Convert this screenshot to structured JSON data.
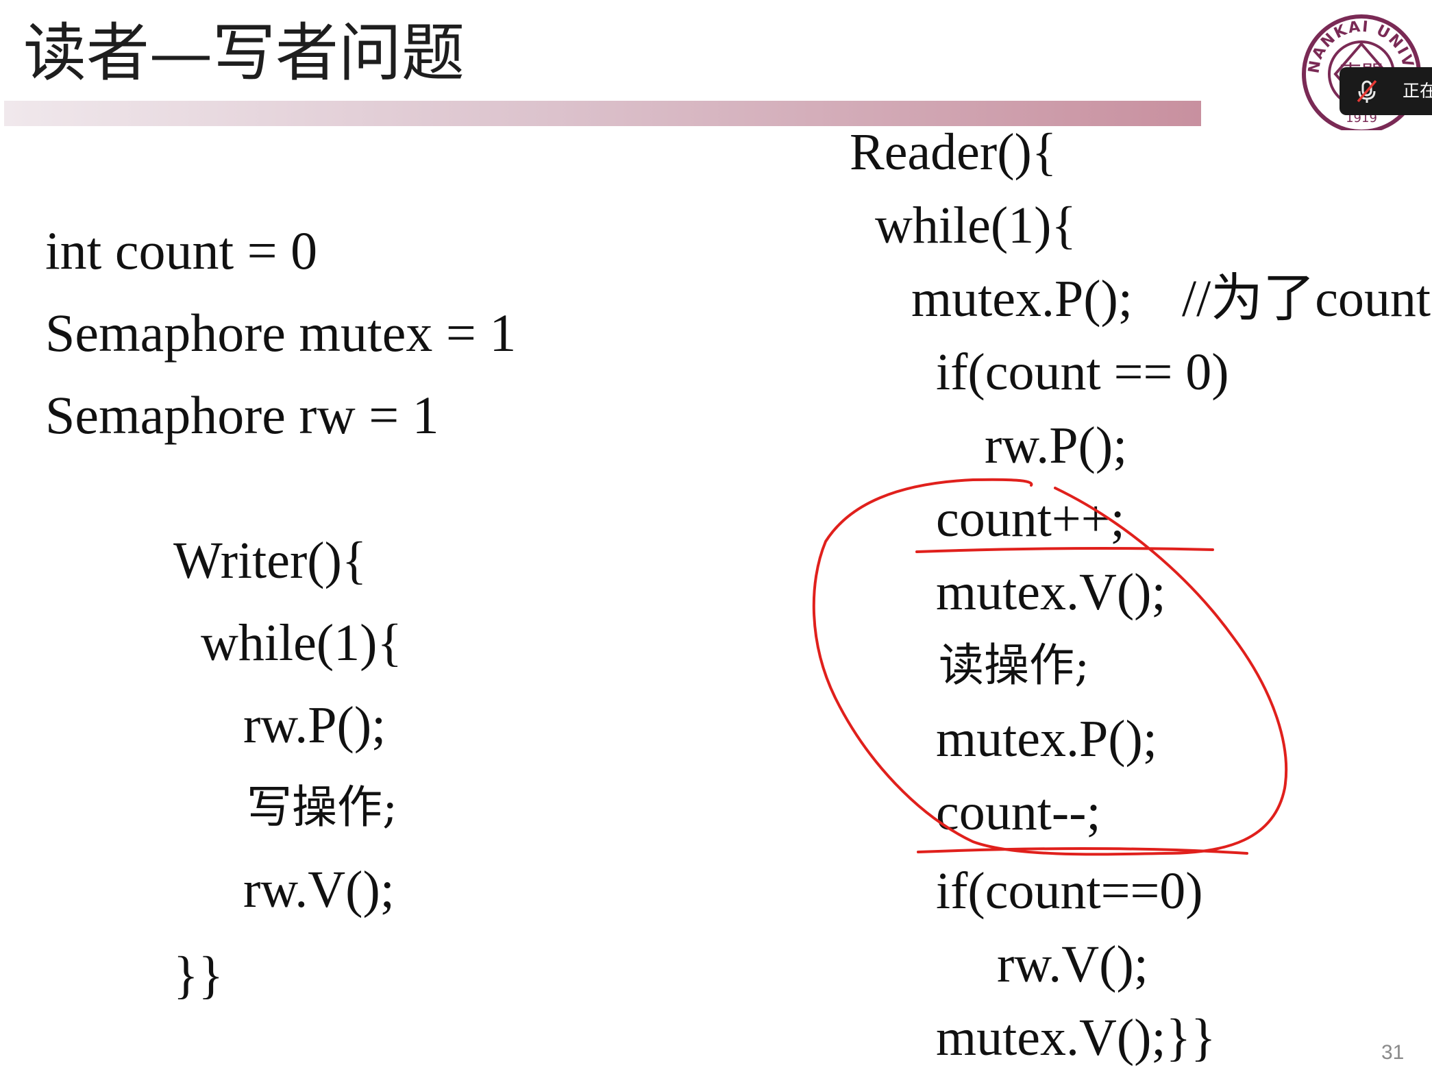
{
  "slide": {
    "title": "读者—写者问题",
    "page_number": "31"
  },
  "logo": {
    "top_lettering": "NANKAI UNIVERSITY",
    "seal_characters": "南開",
    "bottom_mark": "1919"
  },
  "meeting_overlay": {
    "status_text": "正在",
    "icon": "muted-microphone-icon"
  },
  "declarations": [
    "int count = 0",
    "Semaphore mutex = 1",
    "Semaphore rw = 1"
  ],
  "writer": [
    "Writer(){",
    "while(1){",
    "rw.P();",
    "写操作;",
    "rw.V();",
    "}}"
  ],
  "reader": {
    "header": "Reader(){",
    "loop": "while(1){",
    "mutex_p_first": "mutex.P();",
    "comment": "//为了count",
    "if_zero": "if(count == 0)",
    "rw_p": "rw.P();",
    "increment": "count++;",
    "mutex_v_first": "mutex.V();",
    "read_op": "读操作;",
    "mutex_p_second": "mutex.P();",
    "decrement": "count--;",
    "if_zero_second": "if(count==0)",
    "rw_v": "rw.V();",
    "closing": "mutex.V();}}"
  },
  "colors": {
    "annotation_ink": "#e0201c",
    "logo": "#7a2a55",
    "title_bar_end": "#c8909f"
  }
}
